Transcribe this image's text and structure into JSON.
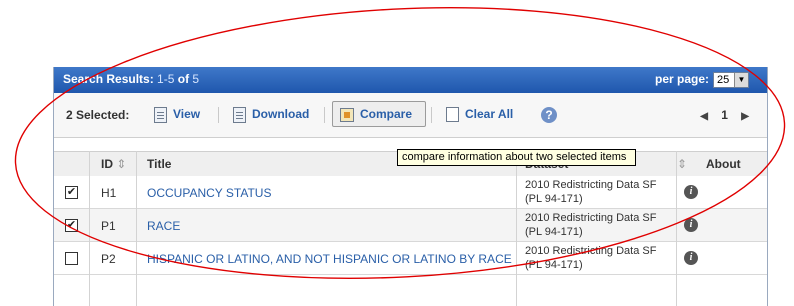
{
  "header": {
    "title_label": "Search Results:",
    "range": "1-5",
    "of_label": "of",
    "total": "5",
    "per_page_label": "per page:",
    "per_page_value": "25"
  },
  "toolbar": {
    "selected_label": "2 Selected:",
    "view_label": "View",
    "download_label": "Download",
    "compare_label": "Compare",
    "clear_label": "Clear All",
    "help_label": "?",
    "page_current": "1"
  },
  "tooltip": "compare information about two selected items",
  "columns": {
    "id": "ID",
    "title": "Title",
    "dataset": "Dataset",
    "about": "About"
  },
  "rows": [
    {
      "checked": true,
      "id": "H1",
      "title": "OCCUPANCY STATUS",
      "dataset_1": "2010 Redistricting Data SF",
      "dataset_2": "(PL 94-171)"
    },
    {
      "checked": true,
      "id": "P1",
      "title": "RACE",
      "dataset_1": "2010 Redistricting Data SF",
      "dataset_2": "(PL 94-171)"
    },
    {
      "checked": false,
      "id": "P2",
      "title": "HISPANIC OR LATINO, AND NOT HISPANIC OR LATINO BY RACE",
      "dataset_1": "2010 Redistricting Data SF",
      "dataset_2": "(PL 94-171)"
    }
  ],
  "colors": {
    "header_blue": "#2b63b8",
    "link_blue": "#2a5fa8",
    "annotation_red": "#e00000",
    "tooltip_bg": "#ffffe1"
  },
  "icons": {
    "view": "document-icon",
    "download": "download-icon",
    "compare": "compare-icon",
    "clear": "clear-icon",
    "help": "help-icon",
    "info": "info-icon",
    "sort": "sort-icon"
  }
}
